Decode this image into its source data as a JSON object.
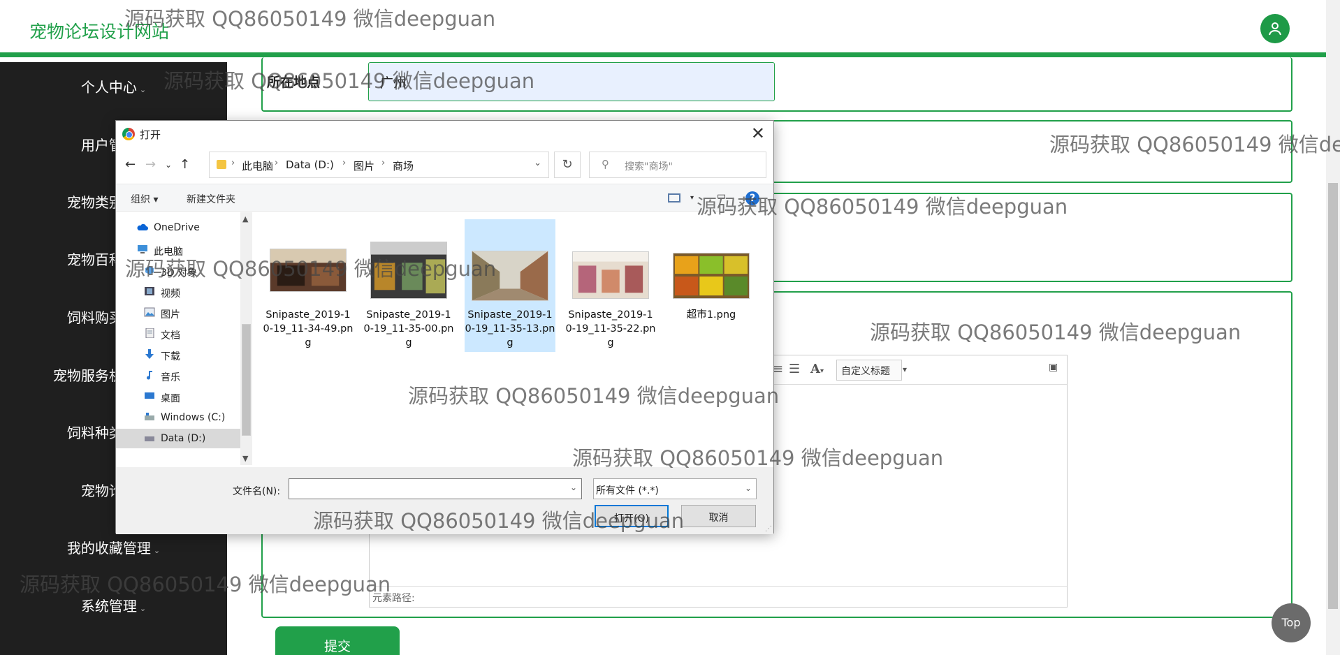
{
  "header": {
    "site_title": "宠物论坛设计网站"
  },
  "sidebar": {
    "items": [
      {
        "label": "个人中心"
      },
      {
        "label": "用户管理"
      },
      {
        "label": "宠物类别管理"
      },
      {
        "label": "宠物百科管理"
      },
      {
        "label": "饲料购买管理"
      },
      {
        "label": "宠物服务机构管理"
      },
      {
        "label": "饲料种类管理"
      },
      {
        "label": "宠物论坛"
      },
      {
        "label": "我的收藏管理"
      },
      {
        "label": "系统管理"
      }
    ]
  },
  "form": {
    "location_label": "所在地点",
    "location_value": "广州",
    "editor_custom_title": "自定义标题",
    "element_path_label": "元素路径:",
    "submit_label": "提交"
  },
  "top_button": "Top",
  "dialog": {
    "title": "打开",
    "breadcrumbs": [
      "此电脑",
      "Data (D:)",
      "图片",
      "商场"
    ],
    "search_placeholder": "搜索\"商场\"",
    "toolbar": {
      "organize": "组织 ▾",
      "new_folder": "新建文件夹"
    },
    "nav_items": [
      {
        "label": "OneDrive",
        "icon": "cloud-icon"
      },
      {
        "label": "此电脑",
        "icon": "computer-icon"
      },
      {
        "label": "3D 对象",
        "icon": "cube-icon"
      },
      {
        "label": "视频",
        "icon": "video-icon"
      },
      {
        "label": "图片",
        "icon": "picture-icon"
      },
      {
        "label": "文档",
        "icon": "document-icon"
      },
      {
        "label": "下载",
        "icon": "download-icon"
      },
      {
        "label": "音乐",
        "icon": "music-icon"
      },
      {
        "label": "桌面",
        "icon": "desktop-icon"
      },
      {
        "label": "Windows (C:)",
        "icon": "drive-icon"
      },
      {
        "label": "Data (D:)",
        "icon": "drive-icon"
      }
    ],
    "files": [
      {
        "name": "Snipaste_2019-10-19_11-34-49.png"
      },
      {
        "name": "Snipaste_2019-10-19_11-35-00.png"
      },
      {
        "name": "Snipaste_2019-10-19_11-35-13.png",
        "selected": true
      },
      {
        "name": "Snipaste_2019-10-19_11-35-22.png"
      },
      {
        "name": "超市1.png"
      }
    ],
    "filename_label": "文件名(N):",
    "filename_value": "",
    "filter_value": "所有文件 (*.*)",
    "open_label": "打开(O)",
    "cancel_label": "取消"
  },
  "watermark": "源码获取 QQ86050149 微信deepguan",
  "colors": {
    "accent": "#21a04a",
    "sidebar_bg": "#1f1f1f",
    "selection": "#cce8ff"
  }
}
